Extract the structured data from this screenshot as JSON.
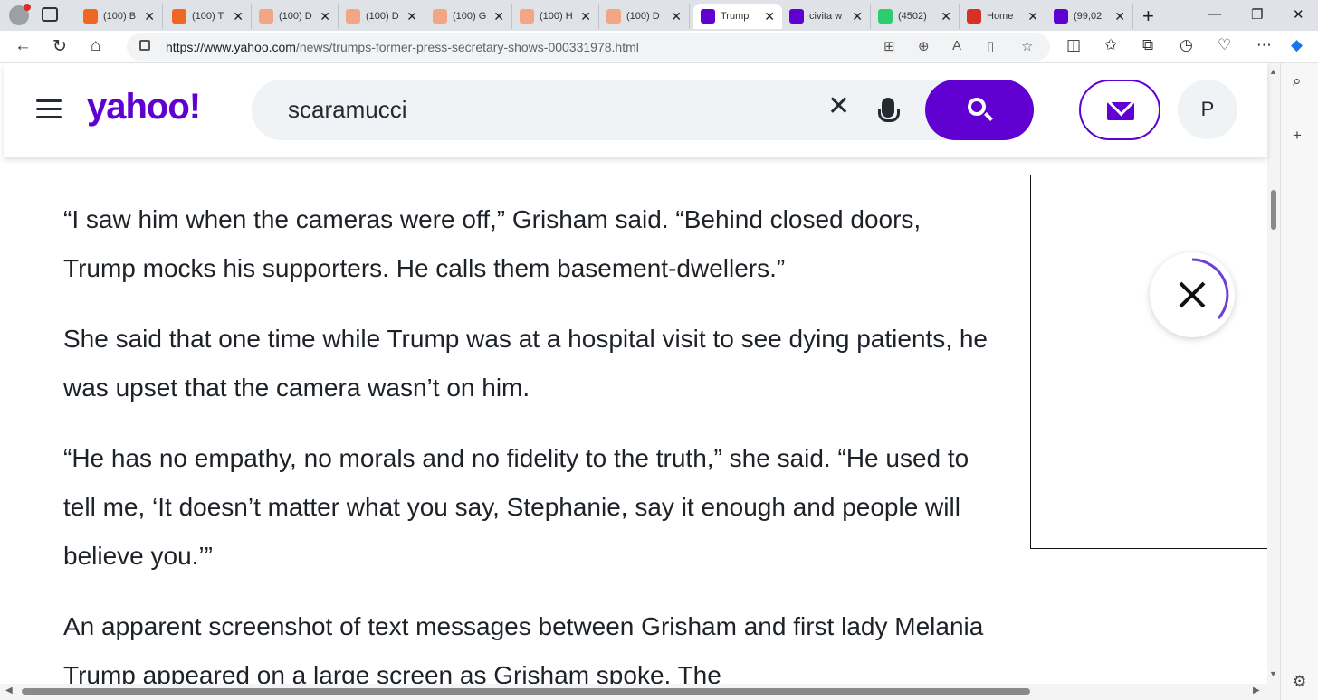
{
  "browser": {
    "tabs": [
      {
        "title": "(100) B",
        "icon_color": "#ee6723",
        "active": false
      },
      {
        "title": "(100) T",
        "icon_color": "#ee6723",
        "active": false
      },
      {
        "title": "(100) D",
        "icon_color": "#f3a683",
        "active": false
      },
      {
        "title": "(100) D",
        "icon_color": "#f3a683",
        "active": false
      },
      {
        "title": "(100) G",
        "icon_color": "#f3a683",
        "active": false
      },
      {
        "title": "(100) H",
        "icon_color": "#f3a683",
        "active": false
      },
      {
        "title": "(100) D",
        "icon_color": "#f3a683",
        "active": false
      },
      {
        "title": "Trump'",
        "icon_color": "#6001d2",
        "active": true
      },
      {
        "title": "civita w",
        "icon_color": "#6001d2",
        "active": false
      },
      {
        "title": "(4502)",
        "icon_color": "#2ecc71",
        "active": false
      },
      {
        "title": "Home",
        "icon_color": "#d93025",
        "active": false
      },
      {
        "title": "(99,02",
        "icon_color": "#6001d2",
        "active": false
      }
    ],
    "url_host": "https://www.yahoo.com",
    "url_path": "/news/trumps-former-press-secretary-shows-000331978.html"
  },
  "header": {
    "logo": "yahoo!",
    "search_value": "scaramucci",
    "avatar_initial": "P",
    "accent_color": "#6001d2"
  },
  "article": {
    "paragraphs": [
      "“I saw him when the cameras were off,” Grisham said. “Behind closed doors, Trump mocks his supporters. He calls them basement-dwellers.”",
      "She said that one time while Trump was at a hospital visit to see dying patients, he was upset that the camera wasn’t on him.",
      "“He has no empathy, no morals and no fidelity to the truth,” she said. “He used to tell me, ‘It doesn’t matter what you say, Stephanie, say it enough and people will believe you.’”",
      "An apparent screenshot of text messages between Grisham and first lady Melania Trump appeared on a large screen as Grisham spoke. The"
    ]
  }
}
